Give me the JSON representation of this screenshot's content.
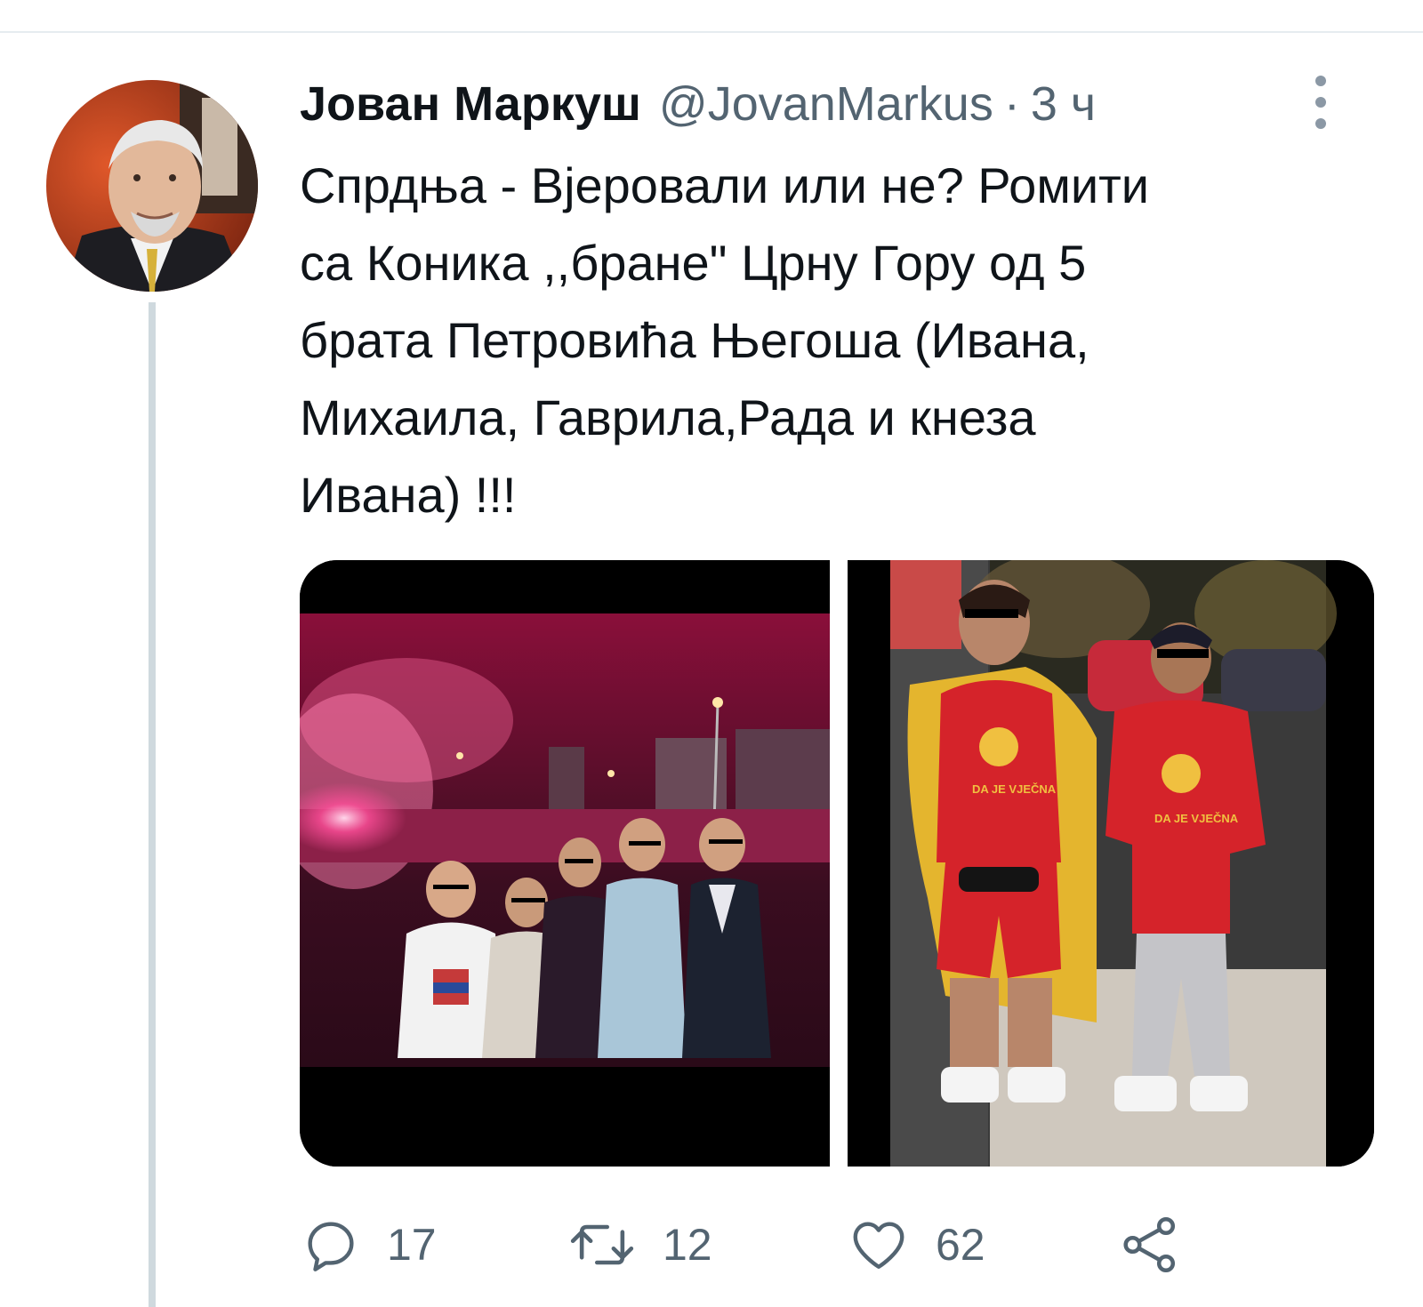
{
  "tweet": {
    "display_name": "Јован Маркуш",
    "handle": "@JovanMarkus",
    "separator": "·",
    "timestamp": "3 ч",
    "text": "Спрдња - Вјеровали или не? Ромити\nса Коника ,,бране\" Црну Гору од 5\nбрата Петровића Његоша (Ивана,\nМихаила, Гаврила,Рада и кнеза\nИвана) !!!",
    "media": [
      {
        "description_icon": "photo-icon",
        "shirt_text": ""
      },
      {
        "description_icon": "photo-icon",
        "shirt_text_1": "DA JE VJEČNA",
        "shirt_text_2": "DA JE VJEČNA"
      }
    ],
    "actions": {
      "reply_icon": "reply-icon",
      "reply_count": "17",
      "retweet_icon": "retweet-icon",
      "retweet_count": "12",
      "like_icon": "heart-icon",
      "like_count": "62",
      "share_icon": "share-icon"
    }
  },
  "colors": {
    "text_primary": "#0f1419",
    "text_secondary": "#536471",
    "thread_line": "#cfd9de",
    "divider": "#e6ecf0"
  }
}
